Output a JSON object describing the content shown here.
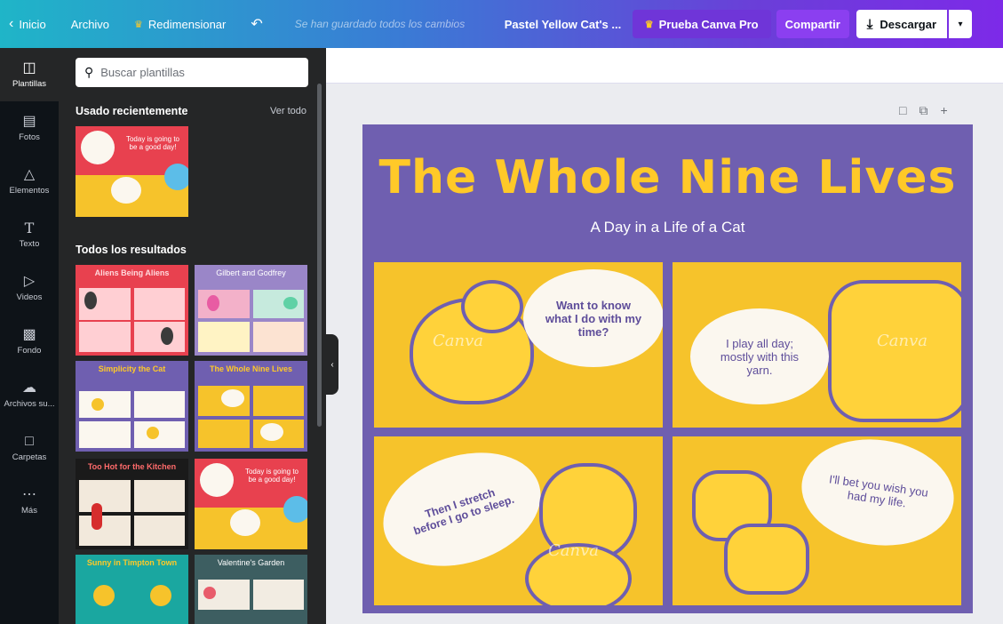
{
  "topbar": {
    "home": "Inicio",
    "file": "Archivo",
    "resize": "Redimensionar",
    "saved": "Se han guardado todos los cambios",
    "doc_title": "Pastel Yellow Cat's ...",
    "pro": "Prueba Canva Pro",
    "share": "Compartir",
    "download": "Descargar"
  },
  "iconbar": [
    {
      "label": "Plantillas",
      "icon": "template-icon"
    },
    {
      "label": "Fotos",
      "icon": "photo-icon"
    },
    {
      "label": "Elementos",
      "icon": "elements-icon"
    },
    {
      "label": "Texto",
      "icon": "text-icon"
    },
    {
      "label": "Videos",
      "icon": "video-icon"
    },
    {
      "label": "Fondo",
      "icon": "background-icon"
    },
    {
      "label": "Archivos su...",
      "icon": "upload-icon"
    },
    {
      "label": "Carpetas",
      "icon": "folder-icon"
    },
    {
      "label": "Más",
      "icon": "more-icon"
    }
  ],
  "panel": {
    "search_placeholder": "Buscar plantillas",
    "recent_heading": "Usado recientemente",
    "see_all": "Ver todo",
    "all_heading": "Todos los resultados",
    "templates": [
      {
        "title": "Aliens Being Aliens",
        "bg": "#e8414f"
      },
      {
        "title": "Gilbert and Godfrey",
        "bg": "#9a86c8"
      },
      {
        "title": "Simplicity the Cat",
        "bg": "#6f5fb0"
      },
      {
        "title": "The Whole Nine Lives",
        "bg": "#6f5fb0"
      },
      {
        "title": "Too Hot for the Kitchen",
        "bg": "#1a1a1a"
      },
      {
        "title": "",
        "bg": "#f2e9dc"
      },
      {
        "title": "Sunny in Timpton Town",
        "bg": "#1aa7a0"
      },
      {
        "title": "Valentine's Garden",
        "bg": "#3d5e61"
      }
    ],
    "recent_text": "Today is going to be a good day!"
  },
  "design": {
    "title": "The Whole Nine Lives",
    "subtitle": "A Day in a Life of a Cat",
    "bubbles": [
      "Want to know what I do with my time?",
      "I play all day; mostly with this yarn.",
      "Then I stretch before I go to sleep.",
      "I'll bet you wish you had my life."
    ],
    "watermark": "Canva"
  }
}
